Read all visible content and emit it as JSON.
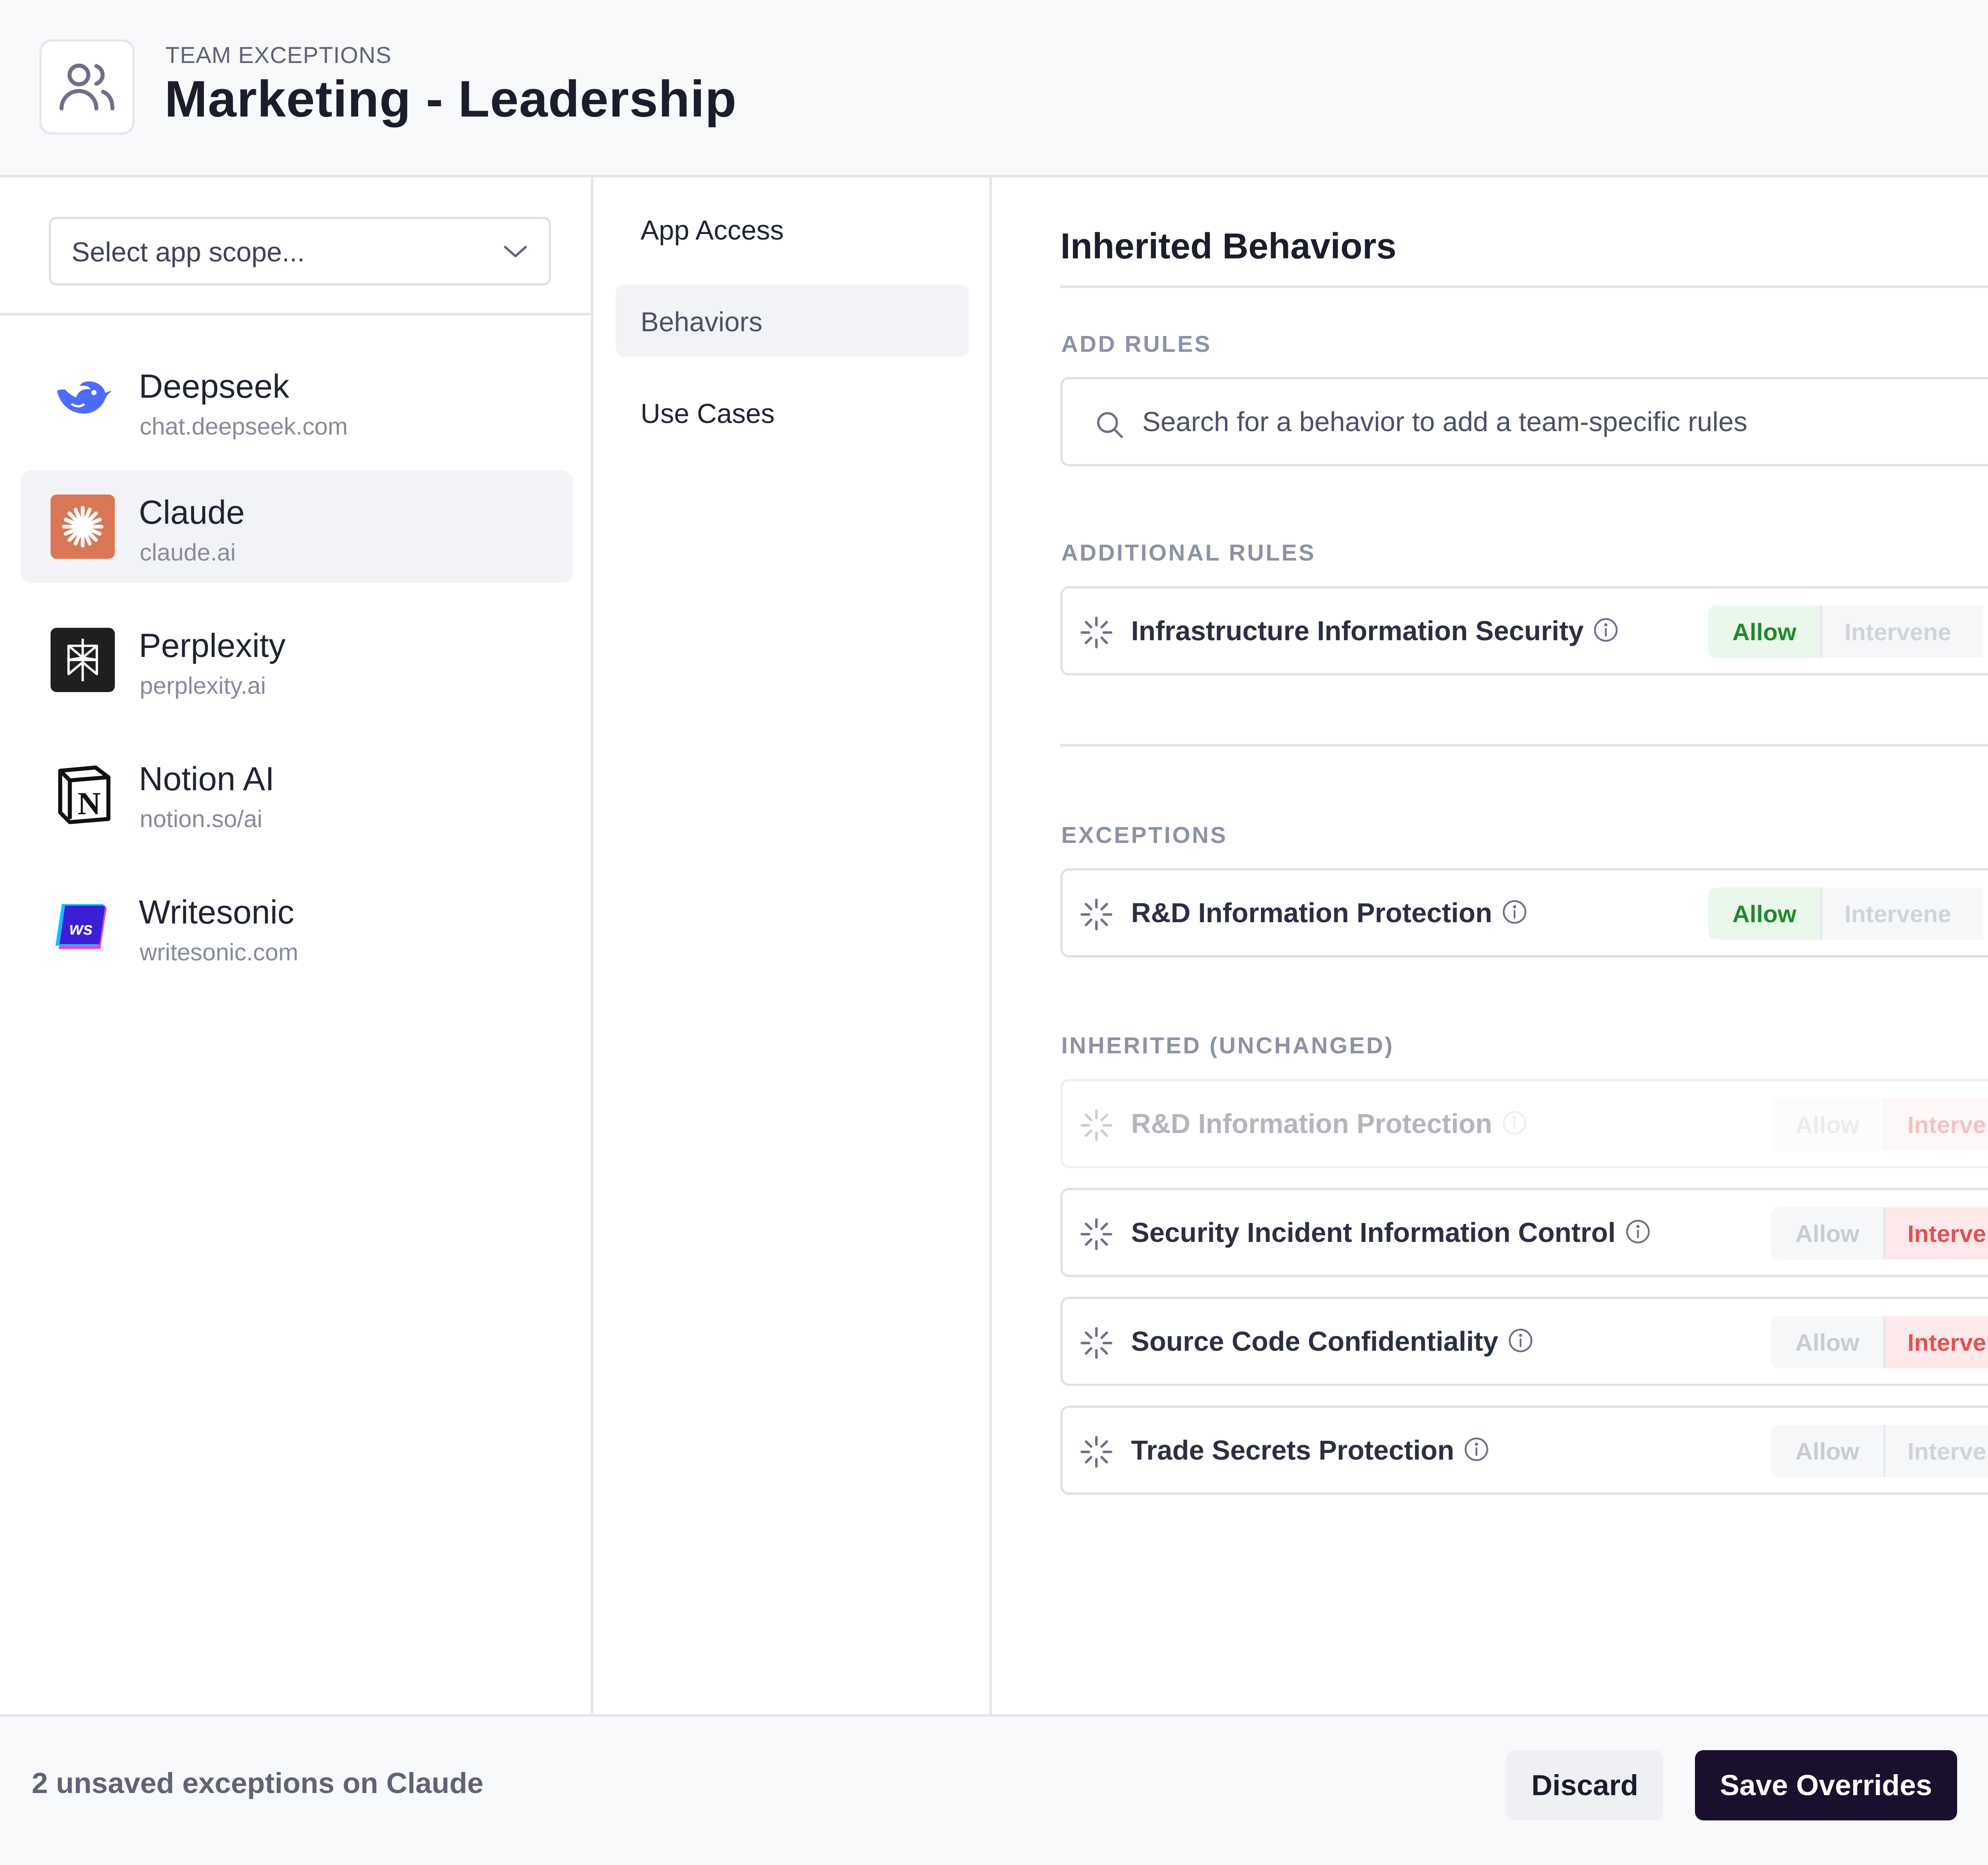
{
  "header": {
    "eyebrow": "TEAM EXCEPTIONS",
    "title": "Marketing - Leadership",
    "icon": "users-icon"
  },
  "scope": {
    "placeholder": "Select app scope..."
  },
  "apps": [
    {
      "name": "Deepseek",
      "url": "chat.deepseek.com",
      "icon": "deepseek-logo",
      "selected": false
    },
    {
      "name": "Claude",
      "url": "claude.ai",
      "icon": "claude-logo",
      "selected": true
    },
    {
      "name": "Perplexity",
      "url": "perplexity.ai",
      "icon": "perplexity-logo",
      "selected": false
    },
    {
      "name": "Notion AI",
      "url": "notion.so/ai",
      "icon": "notion-logo",
      "selected": false
    },
    {
      "name": "Writesonic",
      "url": "writesonic.com",
      "icon": "writesonic-logo",
      "selected": false
    }
  ],
  "nav": [
    {
      "label": "App Access",
      "active": false
    },
    {
      "label": "Behaviors",
      "active": true
    },
    {
      "label": "Use Cases",
      "active": false
    }
  ],
  "main": {
    "title": "Inherited Behaviors",
    "add_rules_label": "ADD RULES",
    "search_placeholder": "Search for a behavior to add a team-specific rules",
    "additional_label": "ADDITIONAL RULES",
    "exceptions_label": "EXCEPTIONS",
    "inherited_label": "INHERITED (UNCHANGED)",
    "additional_rules": [
      {
        "name": "Infrastructure Information Security",
        "allow": "Allow",
        "intervene": "Intervene",
        "state": "allow"
      }
    ],
    "exceptions": [
      {
        "name": "R&D Information Protection",
        "allow": "Allow",
        "intervene": "Intervene",
        "state": "allow"
      }
    ],
    "inherited": [
      {
        "name": "R&D Information Protection",
        "allow": "Allow",
        "intervene": "Interve",
        "state": "intervene",
        "faded": true
      },
      {
        "name": "Security Incident Information Control",
        "allow": "Allow",
        "intervene": "Interve",
        "state": "intervene",
        "faded": false
      },
      {
        "name": "Source Code Confidentiality",
        "allow": "Allow",
        "intervene": "Interve",
        "state": "intervene",
        "faded": false
      },
      {
        "name": "Trade Secrets Protection",
        "allow": "Allow",
        "intervene": "Interve",
        "state": "none",
        "faded": false
      }
    ]
  },
  "footer": {
    "status": "2 unsaved exceptions on Claude",
    "discard_label": "Discard",
    "save_label": "Save Overrides"
  },
  "colors": {
    "allow_active": "#1f8a2a",
    "intervene_active": "#e05252",
    "save_button": "#1b0f2e",
    "claude_brand": "#d97757",
    "deepseek_brand": "#4d6bfe"
  }
}
